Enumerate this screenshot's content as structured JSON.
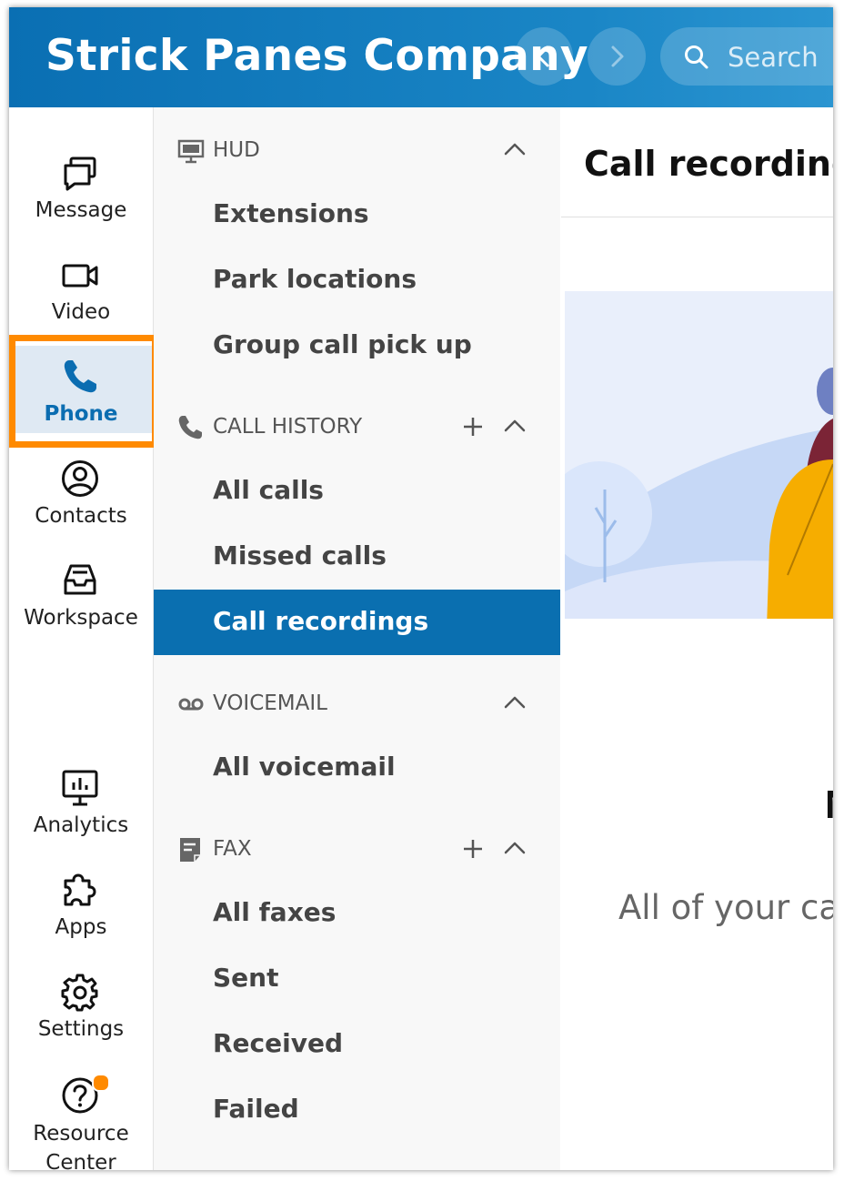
{
  "app": {
    "company": "Strick Panes Company",
    "search_placeholder": "Search",
    "accent_color": "#0a6fb0",
    "highlight_color": "#ff8a00"
  },
  "left_nav": {
    "items": [
      {
        "label": "Message",
        "icon": "message-icon"
      },
      {
        "label": "Video",
        "icon": "video-icon"
      },
      {
        "label": "Phone",
        "icon": "phone-icon",
        "selected": true
      },
      {
        "label": "Contacts",
        "icon": "contacts-icon"
      },
      {
        "label": "Workspace",
        "icon": "workspace-icon"
      },
      {
        "label": "Analytics",
        "icon": "analytics-icon"
      },
      {
        "label": "Apps",
        "icon": "puzzle-icon"
      },
      {
        "label": "Settings",
        "icon": "gear-icon"
      },
      {
        "label": "Resource Center",
        "icon": "help-icon",
        "badge": true
      }
    ]
  },
  "sub_nav": {
    "sections": [
      {
        "title": "HUD",
        "icon": "monitor-icon",
        "items": [
          "Extensions",
          "Park locations",
          "Group call pick up"
        ]
      },
      {
        "title": "CALL HISTORY",
        "icon": "phone-icon",
        "items": [
          "All calls",
          "Missed calls",
          "Call recordings"
        ],
        "active": "Call recordings"
      },
      {
        "title": "VOICEMAIL",
        "icon": "voicemail-icon",
        "items": [
          "All voicemail"
        ]
      },
      {
        "title": "FAX",
        "icon": "fax-icon",
        "items": [
          "All faxes",
          "Sent",
          "Received",
          "Failed"
        ]
      }
    ]
  },
  "main": {
    "title": "Call recordings",
    "empty_title": "N",
    "empty_desc": "All of your cal"
  }
}
